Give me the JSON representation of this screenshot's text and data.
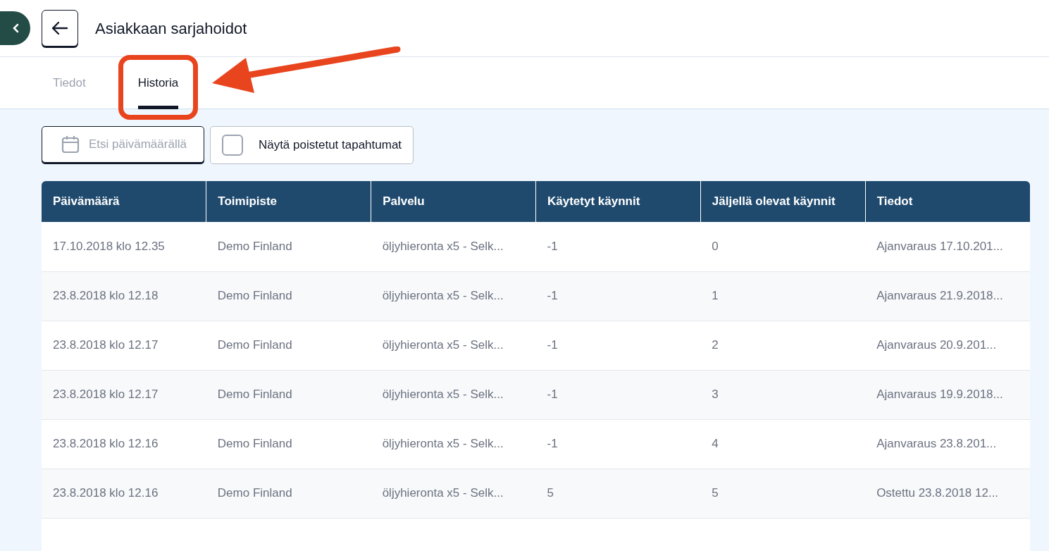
{
  "header": {
    "title": "Asiakkaan sarjahoidot"
  },
  "tabs": [
    {
      "label": "Tiedot",
      "selected": false
    },
    {
      "label": "Historia",
      "selected": true
    }
  ],
  "annotation": {
    "kind": "highlight-arrow"
  },
  "toolbar": {
    "date_search": {
      "label": "Etsi päivämäärällä"
    },
    "show_deleted": {
      "label": "Näytä poistetut tapahtumat",
      "checked": false
    }
  },
  "table": {
    "columns": [
      "Päivämäärä",
      "Toimipiste",
      "Palvelu",
      "Käytetyt käynnit",
      "Jäljellä olevat käynnit",
      "Tiedot"
    ],
    "rows": [
      [
        "17.10.2018 klo 12.35",
        "Demo Finland",
        "öljyhieronta x5 - Selk...",
        "-1",
        "0",
        "Ajanvaraus 17.10.201..."
      ],
      [
        "23.8.2018 klo 12.18",
        "Demo Finland",
        "öljyhieronta x5 - Selk...",
        "-1",
        "1",
        "Ajanvaraus 21.9.2018..."
      ],
      [
        "23.8.2018 klo 12.17",
        "Demo Finland",
        "öljyhieronta x5 - Selk...",
        "-1",
        "2",
        "Ajanvaraus 20.9.201..."
      ],
      [
        "23.8.2018 klo 12.17",
        "Demo Finland",
        "öljyhieronta x5 - Selk...",
        "-1",
        "3",
        "Ajanvaraus 19.9.2018..."
      ],
      [
        "23.8.2018 klo 12.16",
        "Demo Finland",
        "öljyhieronta x5 - Selk...",
        "-1",
        "4",
        "Ajanvaraus 23.8.201..."
      ],
      [
        "23.8.2018 klo 12.16",
        "Demo Finland",
        "öljyhieronta x5 - Selk...",
        "5",
        "5",
        "Ostettu 23.8.2018 12..."
      ]
    ]
  }
}
